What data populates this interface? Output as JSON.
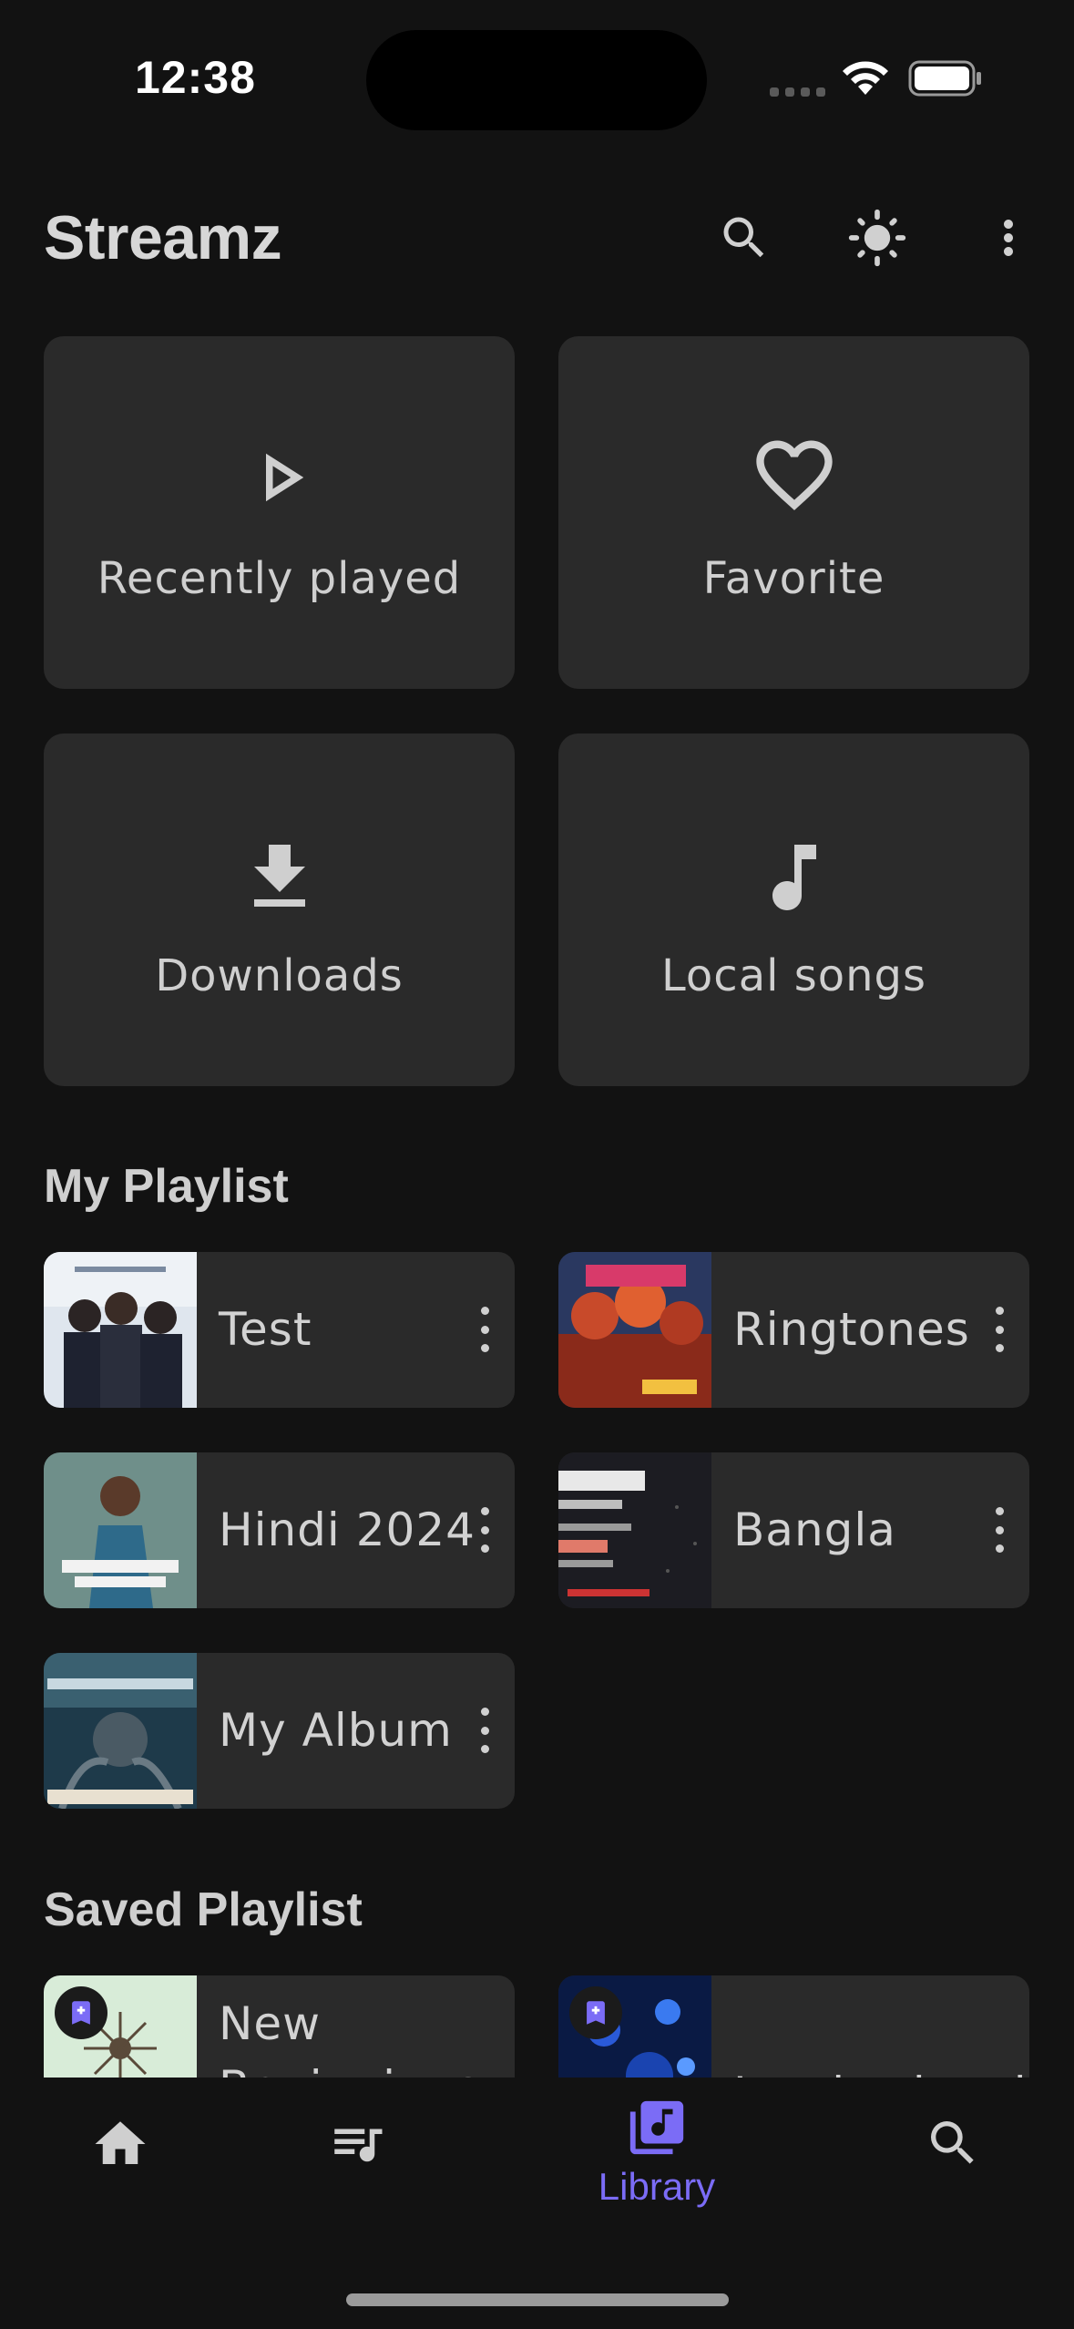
{
  "status_bar": {
    "time": "12:38"
  },
  "header": {
    "title": "Streamz"
  },
  "quick_tiles": [
    {
      "label": "Recently played",
      "icon": "play-icon"
    },
    {
      "label": "Favorite",
      "icon": "heart-icon"
    },
    {
      "label": "Downloads",
      "icon": "download-icon"
    },
    {
      "label": "Local songs",
      "icon": "music-note-icon"
    }
  ],
  "my_playlist": {
    "title": "My Playlist",
    "items": [
      {
        "name": "Test"
      },
      {
        "name": "Ringtones"
      },
      {
        "name": "Hindi 2024"
      },
      {
        "name": "Bangla"
      },
      {
        "name": "My Album"
      }
    ]
  },
  "saved_playlist": {
    "title": "Saved Playlist",
    "items": [
      {
        "name": "New Beginnings"
      },
      {
        "name": "Inspirational"
      }
    ]
  },
  "bottom_nav": {
    "items": [
      {
        "icon": "home-icon"
      },
      {
        "icon": "queue-music-icon"
      },
      {
        "icon": "library-music-icon",
        "label": "Library"
      },
      {
        "icon": "search-icon"
      }
    ],
    "active_color": "#7b6cf6"
  },
  "colors": {
    "background": "#121212",
    "card": "#2a2a2a",
    "accent": "#7b6cf6"
  }
}
